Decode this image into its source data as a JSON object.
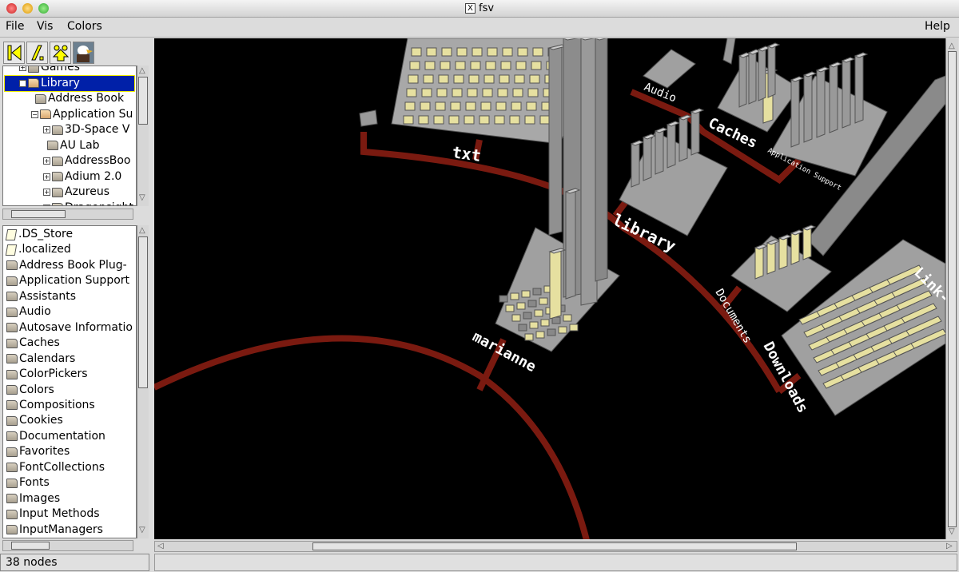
{
  "window": {
    "title": "fsv"
  },
  "menu": {
    "file": "File",
    "vis": "Vis",
    "colors": "Colors",
    "help": "Help"
  },
  "toolbar": {
    "icons": [
      "back-to-root-icon",
      "cd-icon",
      "up-icon",
      "birdseye-view-icon"
    ]
  },
  "tree": {
    "items": [
      {
        "label": "Games",
        "expander": "+",
        "partial": true
      },
      {
        "label": "Library",
        "expander": "-",
        "selected": true
      },
      {
        "label": "Address Book",
        "expander": ""
      },
      {
        "label": "Application Su",
        "expander": "-"
      },
      {
        "label": "3D-Space V",
        "expander": "+"
      },
      {
        "label": "AU Lab",
        "expander": ""
      },
      {
        "label": "AddressBoo",
        "expander": "+"
      },
      {
        "label": "Adium 2.0",
        "expander": "+"
      },
      {
        "label": "Azureus",
        "expander": "+"
      },
      {
        "label": "Dragonsight",
        "expander": "+",
        "partial": true
      }
    ]
  },
  "list": {
    "items": [
      {
        "label": ".DS_Store",
        "type": "file"
      },
      {
        "label": ".localized",
        "type": "file"
      },
      {
        "label": "Address Book Plug-",
        "type": "folder"
      },
      {
        "label": "Application Support",
        "type": "folder"
      },
      {
        "label": "Assistants",
        "type": "folder"
      },
      {
        "label": "Audio",
        "type": "folder"
      },
      {
        "label": "Autosave Informatio",
        "type": "folder"
      },
      {
        "label": "Caches",
        "type": "folder"
      },
      {
        "label": "Calendars",
        "type": "folder"
      },
      {
        "label": "ColorPickers",
        "type": "folder"
      },
      {
        "label": "Colors",
        "type": "folder"
      },
      {
        "label": "Compositions",
        "type": "folder"
      },
      {
        "label": "Cookies",
        "type": "folder"
      },
      {
        "label": "Documentation",
        "type": "folder"
      },
      {
        "label": "Favorites",
        "type": "folder"
      },
      {
        "label": "FontCollections",
        "type": "folder"
      },
      {
        "label": "Fonts",
        "type": "folder"
      },
      {
        "label": "Images",
        "type": "folder"
      },
      {
        "label": "Input Methods",
        "type": "folder"
      },
      {
        "label": "InputManagers",
        "type": "folder"
      }
    ]
  },
  "status": {
    "nodes": "38 nodes"
  },
  "viz": {
    "labels": {
      "txt": "txt",
      "library": "library",
      "marianne": "marianne",
      "audio": "Audio",
      "caches": "Caches",
      "app_support": "Application Support",
      "documents": "Documents",
      "downloads": "Downloads",
      "link": "Link-"
    },
    "colors": {
      "background": "#000000",
      "branch": "#7a1a10",
      "platform": "#a0a0a0",
      "file": "#e6e0a0"
    }
  }
}
